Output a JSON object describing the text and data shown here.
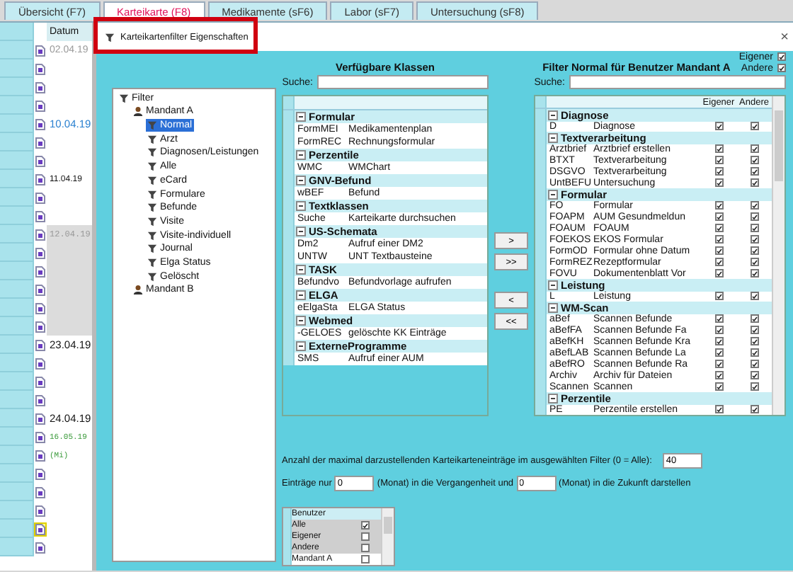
{
  "tabs": [
    {
      "label": "Übersicht (F7)",
      "selected": false
    },
    {
      "label": "Karteikarte (F8)",
      "selected": true
    },
    {
      "label": "Medikamente (sF6)",
      "selected": false
    },
    {
      "label": "Labor (sF7)",
      "selected": false
    },
    {
      "label": "Untersuchung (sF8)",
      "selected": false
    }
  ],
  "journal": {
    "header": "Datum",
    "rows": [
      {
        "date": "02.04.19",
        "kind": "faded"
      },
      {
        "kind": "plain"
      },
      {
        "kind": "plain"
      },
      {
        "kind": "plain"
      },
      {
        "date": "10.04.19",
        "kind": "link"
      },
      {
        "kind": "plain"
      },
      {
        "kind": "plain"
      },
      {
        "date": "11.04.19",
        "kind": "small"
      },
      {
        "kind": "plain"
      },
      {
        "kind": "plain"
      },
      {
        "date": "12.04.19",
        "kind": "shaded"
      },
      {
        "kind": "shaded"
      },
      {
        "kind": "shaded"
      },
      {
        "kind": "shaded"
      },
      {
        "kind": "shaded"
      },
      {
        "kind": "shaded"
      },
      {
        "date": "23.04.19",
        "kind": "large"
      },
      {
        "kind": "plain"
      },
      {
        "kind": "plain"
      },
      {
        "kind": "plain"
      },
      {
        "date": "24.04.19",
        "kind": "large"
      },
      {
        "date": "16.05.19",
        "kind": "green"
      },
      {
        "date": "(Mi)",
        "kind": "green"
      },
      {
        "kind": "plain"
      },
      {
        "kind": "plain"
      },
      {
        "kind": "plain"
      },
      {
        "kind": "plain",
        "highlighted": true
      },
      {
        "kind": "plain"
      }
    ]
  },
  "dialog": {
    "title": "Karteikartenfilter Eigenschaften",
    "close": "×",
    "tree": {
      "label": "Filter",
      "kind": "filter",
      "children": [
        {
          "label": "Mandant A",
          "kind": "user",
          "children": [
            {
              "label": "Normal",
              "kind": "filter",
              "selected": true
            },
            {
              "label": "Arzt",
              "kind": "filter",
              "selected": false
            },
            {
              "label": "Diagnosen/Leistungen",
              "kind": "filter",
              "selected": false
            },
            {
              "label": "Alle",
              "kind": "filter",
              "selected": false
            },
            {
              "label": "eCard",
              "kind": "filter",
              "selected": false
            },
            {
              "label": "Formulare",
              "kind": "filter",
              "selected": false
            },
            {
              "label": "Befunde",
              "kind": "filter",
              "selected": false
            },
            {
              "label": "Visite",
              "kind": "filter",
              "selected": false
            },
            {
              "label": "Visite-individuell",
              "kind": "filter",
              "selected": false
            },
            {
              "label": "Journal",
              "kind": "filter",
              "selected": false
            },
            {
              "label": "Elga Status",
              "kind": "filter",
              "selected": false
            },
            {
              "label": "Gelöscht",
              "kind": "filter",
              "selected": false
            }
          ]
        },
        {
          "label": "Mandant B",
          "kind": "user"
        }
      ]
    },
    "available": {
      "title": "Verfügbare Klassen",
      "search_label": "Suche:",
      "groups": [
        {
          "name": "Formular",
          "expanded": true,
          "rows": [
            {
              "code": "FormMEI",
              "name": "Medikamentenplan"
            },
            {
              "code": "FormREC",
              "name": "Rechnungsformular"
            }
          ]
        },
        {
          "name": "Perzentile",
          "expanded": true,
          "rows": [
            {
              "code": "WMC",
              "name": "WMChart"
            }
          ]
        },
        {
          "name": "GNV-Befund",
          "expanded": true,
          "rows": [
            {
              "code": "wBEF",
              "name": "Befund"
            }
          ]
        },
        {
          "name": "Textklassen",
          "expanded": true,
          "rows": [
            {
              "code": "Suche",
              "name": "Karteikarte durchsuchen"
            }
          ]
        },
        {
          "name": "US-Schemata",
          "expanded": true,
          "rows": [
            {
              "code": "Dm2",
              "name": "Aufruf einer DM2"
            },
            {
              "code": "UNTW",
              "name": "UNT Textbausteine"
            }
          ]
        },
        {
          "name": "TASK",
          "expanded": true,
          "rows": [
            {
              "code": "Befundvo",
              "name": "Befundvorlage aufrufen"
            }
          ]
        },
        {
          "name": "ELGA",
          "expanded": true,
          "rows": [
            {
              "code": "eElgaSta",
              "name": "ELGA Status"
            }
          ]
        },
        {
          "name": "Webmed",
          "expanded": true,
          "rows": [
            {
              "code": "-GELOES",
              "name": "gelöschte KK Einträge"
            }
          ]
        },
        {
          "name": "ExterneProgramme",
          "expanded": true,
          "rows": [
            {
              "code": "SMS",
              "name": "Aufruf einer AUM"
            }
          ]
        }
      ]
    },
    "move_buttons": [
      ">",
      ">>",
      "<",
      "<<"
    ],
    "filter": {
      "title": "Filter Normal für Benutzer Mandant A",
      "options": [
        {
          "label": "Eigener",
          "checked": true
        },
        {
          "label": "Andere",
          "checked": true
        }
      ],
      "search_label": "Suche:",
      "columns": [
        "Eigener",
        "Andere"
      ],
      "groups": [
        {
          "name": "Diagnose",
          "expanded": true,
          "rows": [
            {
              "code": "D",
              "name": "Diagnose",
              "own": true,
              "other": true
            }
          ]
        },
        {
          "name": "Textverarbeitung",
          "expanded": true,
          "rows": [
            {
              "code": "Arztbrief",
              "name": "Arztbrief erstellen",
              "own": true,
              "other": true
            },
            {
              "code": "BTXT",
              "name": "Textverarbeitung",
              "own": true,
              "other": true
            },
            {
              "code": "DSGVO",
              "name": "Textverarbeitung",
              "own": true,
              "other": true
            },
            {
              "code": "UntBEFU",
              "name": "Untersuchung",
              "own": true,
              "other": true
            }
          ]
        },
        {
          "name": "Formular",
          "expanded": true,
          "rows": [
            {
              "code": "FO",
              "name": "Formular",
              "own": true,
              "other": true
            },
            {
              "code": "FOAPM",
              "name": "AUM Gesundmeldun",
              "own": true,
              "other": true
            },
            {
              "code": "FOAUM",
              "name": "FOAUM",
              "own": true,
              "other": true
            },
            {
              "code": "FOEKOS",
              "name": "EKOS Formular",
              "own": true,
              "other": true
            },
            {
              "code": "FormOD",
              "name": "Formular ohne Datum",
              "own": true,
              "other": true
            },
            {
              "code": "FormREZ",
              "name": "Rezeptformular",
              "own": true,
              "other": true
            },
            {
              "code": "FOVU",
              "name": "Dokumentenblatt Vor",
              "own": true,
              "other": true
            }
          ]
        },
        {
          "name": "Leistung",
          "expanded": true,
          "rows": [
            {
              "code": "L",
              "name": "Leistung",
              "own": true,
              "other": true
            }
          ]
        },
        {
          "name": "WM-Scan",
          "expanded": true,
          "rows": [
            {
              "code": "aBef",
              "name": "Scannen Befunde",
              "own": true,
              "other": true
            },
            {
              "code": "aBefFA",
              "name": "Scannen Befunde Fa",
              "own": true,
              "other": true
            },
            {
              "code": "aBefKH",
              "name": "Scannen Befunde Kra",
              "own": true,
              "other": true
            },
            {
              "code": "aBefLAB",
              "name": "Scannen Befunde La",
              "own": true,
              "other": true
            },
            {
              "code": "aBefRO",
              "name": "Scannen Befunde Ra",
              "own": true,
              "other": true
            },
            {
              "code": "Archiv",
              "name": "Archiv für Dateien",
              "own": true,
              "other": true
            },
            {
              "code": "Scannen",
              "name": "Scannen",
              "own": true,
              "other": true
            }
          ]
        },
        {
          "name": "Perzentile",
          "expanded": true,
          "rows": [
            {
              "code": "PE",
              "name": "Perzentile erstellen",
              "own": true,
              "other": true
            }
          ]
        }
      ],
      "max_entries": {
        "label": "Anzahl der maximal darzustellenden Karteikarteneinträge im ausgewählten Filter (0 = Alle):",
        "value": "40"
      },
      "range": {
        "prefix": "Einträge nur",
        "past": "0",
        "middle": "(Monat) in die Vergangenheit und",
        "future": "0",
        "suffix": "(Monat) in die Zukunft darstellen"
      },
      "users": {
        "header": "Benutzer",
        "rows": [
          {
            "name": "Alle",
            "checked": true,
            "selected": true
          },
          {
            "name": "Eigener",
            "checked": false,
            "selected": true
          },
          {
            "name": "Andere",
            "checked": false,
            "selected": true
          },
          {
            "name": "Mandant A",
            "checked": false,
            "selected": false
          }
        ]
      }
    }
  }
}
